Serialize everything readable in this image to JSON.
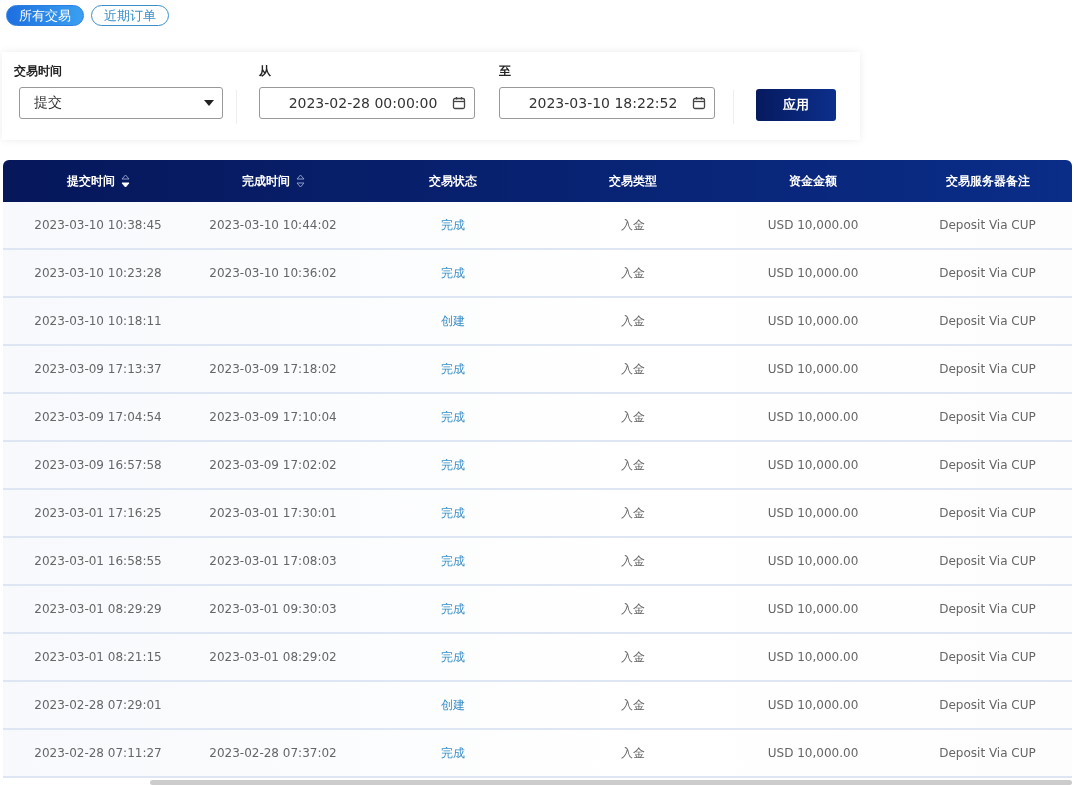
{
  "tabs": [
    {
      "label": "所有交易",
      "selected": true
    },
    {
      "label": "近期订单",
      "selected": false
    }
  ],
  "filter": {
    "time_label": "交易时间",
    "time_value": "提交",
    "from_label": "从",
    "from_value": "2023-02-28 00:00:00",
    "to_label": "至",
    "to_value": "2023-03-10 18:22:52",
    "apply": "应用"
  },
  "table": {
    "columns": [
      {
        "label": "提交时间",
        "sorted": true
      },
      {
        "label": "完成时间",
        "sorted": false
      },
      {
        "label": "交易状态"
      },
      {
        "label": "交易类型"
      },
      {
        "label": "资金金额"
      },
      {
        "label": "交易服务器备注"
      }
    ],
    "rows": [
      [
        "2023-03-10 10:38:45",
        "2023-03-10 10:44:02",
        "完成",
        "入金",
        "USD 10,000.00",
        "Deposit Via CUP"
      ],
      [
        "2023-03-10 10:23:28",
        "2023-03-10 10:36:02",
        "完成",
        "入金",
        "USD 10,000.00",
        "Deposit Via CUP"
      ],
      [
        "2023-03-10 10:18:11",
        "",
        "创建",
        "入金",
        "USD 10,000.00",
        "Deposit Via CUP"
      ],
      [
        "2023-03-09 17:13:37",
        "2023-03-09 17:18:02",
        "完成",
        "入金",
        "USD 10,000.00",
        "Deposit Via CUP"
      ],
      [
        "2023-03-09 17:04:54",
        "2023-03-09 17:10:04",
        "完成",
        "入金",
        "USD 10,000.00",
        "Deposit Via CUP"
      ],
      [
        "2023-03-09 16:57:58",
        "2023-03-09 17:02:02",
        "完成",
        "入金",
        "USD 10,000.00",
        "Deposit Via CUP"
      ],
      [
        "2023-03-01 17:16:25",
        "2023-03-01 17:30:01",
        "完成",
        "入金",
        "USD 10,000.00",
        "Deposit Via CUP"
      ],
      [
        "2023-03-01 16:58:55",
        "2023-03-01 17:08:03",
        "完成",
        "入金",
        "USD 10,000.00",
        "Deposit Via CUP"
      ],
      [
        "2023-03-01 08:29:29",
        "2023-03-01 09:30:03",
        "完成",
        "入金",
        "USD 10,000.00",
        "Deposit Via CUP"
      ],
      [
        "2023-03-01 08:21:15",
        "2023-03-01 08:29:02",
        "完成",
        "入金",
        "USD 10,000.00",
        "Deposit Via CUP"
      ],
      [
        "2023-02-28 07:29:01",
        "",
        "创建",
        "入金",
        "USD 10,000.00",
        "Deposit Via CUP"
      ],
      [
        "2023-02-28 07:11:27",
        "2023-02-28 07:37:02",
        "完成",
        "入金",
        "USD 10,000.00",
        "Deposit Via CUP"
      ]
    ]
  }
}
